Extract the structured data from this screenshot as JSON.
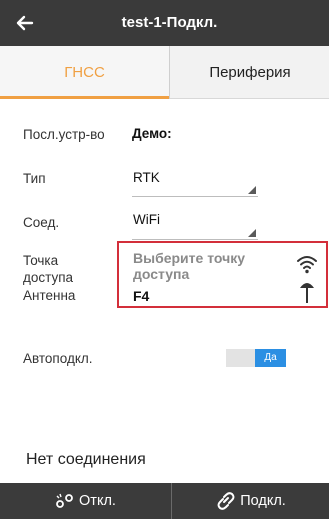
{
  "header": {
    "title": "test-1-Подкл.",
    "back_icon": "arrow-left-icon"
  },
  "tabs": [
    {
      "label": "ГНСС",
      "active": true
    },
    {
      "label": "Периферия",
      "active": false
    }
  ],
  "form": {
    "device": {
      "label": "Посл.устр-во",
      "value": "Демо:"
    },
    "type": {
      "label": "Тип",
      "value": "RTK"
    },
    "connection": {
      "label": "Соед.",
      "value": "WiFi"
    },
    "access_point": {
      "label": "Точка доступа",
      "value": "Выберите точку доступа",
      "icon": "wifi-icon"
    },
    "antenna": {
      "label": "Антенна",
      "value": "F4",
      "icon": "antenna-icon"
    },
    "autoconnect": {
      "label": "Автоподкл.",
      "value": "Да"
    }
  },
  "status": {
    "text": "Нет соединения"
  },
  "bottom": {
    "disconnect_label": "Откл.",
    "connect_label": "Подкл."
  },
  "colors": {
    "accent": "#f0a043",
    "highlight_border": "#d32f3a",
    "toggle_on": "#2b8fe3",
    "bar": "#3a3a3a"
  }
}
